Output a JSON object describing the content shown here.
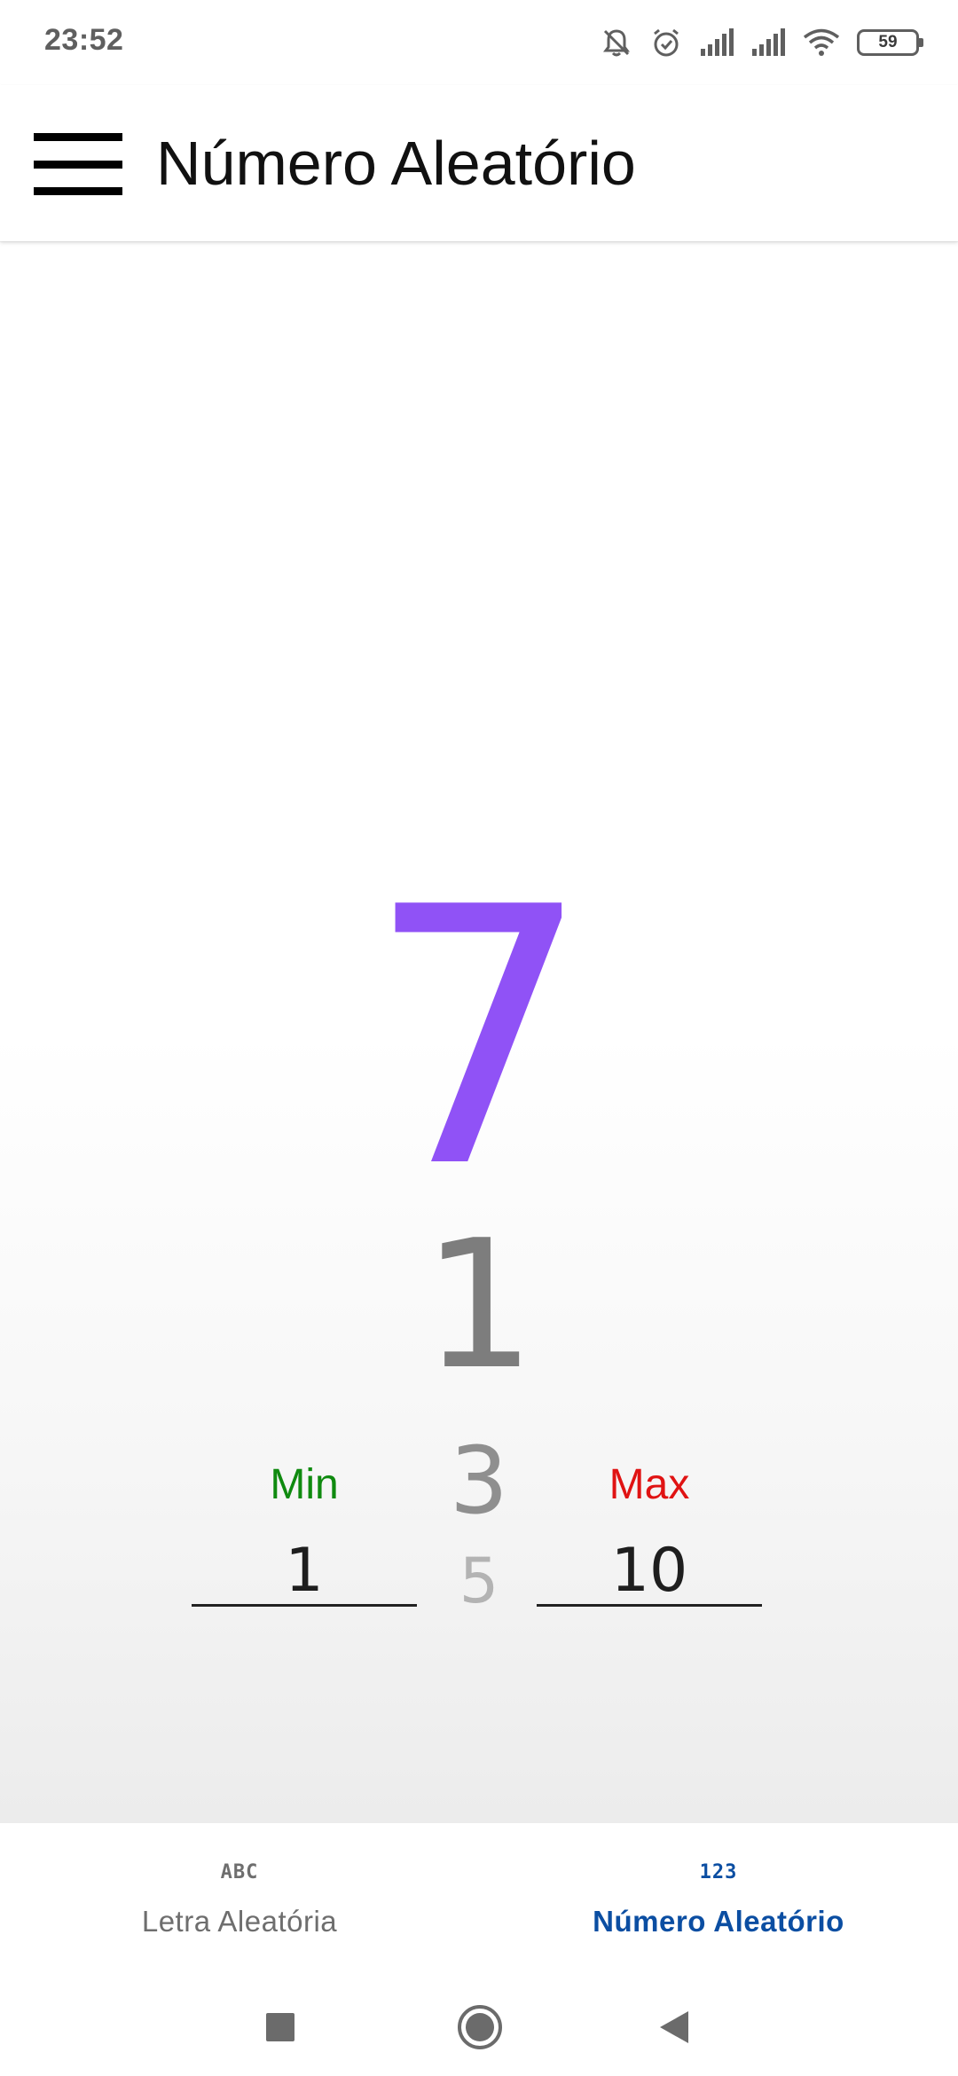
{
  "status_bar": {
    "time": "23:52",
    "battery_level": "59",
    "icons": [
      "notifications-off-icon",
      "alarm-icon",
      "signal-icon",
      "signal-icon",
      "wifi-icon",
      "battery-icon"
    ]
  },
  "app_bar": {
    "title": "Número Aleatório",
    "menu_icon": "hamburger-menu-icon"
  },
  "main": {
    "result": "7",
    "wheel": [
      "1",
      "3",
      "5"
    ],
    "min": {
      "label": "Min",
      "value": "1"
    },
    "max": {
      "label": "Max",
      "value": "10"
    }
  },
  "bottom_nav": {
    "items": [
      {
        "icon_text": "ABC",
        "label": "Letra Aleatória",
        "active": false
      },
      {
        "icon_text": "123",
        "label": "Número Aleatório",
        "active": true
      }
    ]
  },
  "system_nav": {
    "buttons": [
      "recents-icon",
      "home-icon",
      "back-icon"
    ]
  },
  "colors": {
    "result": "#9052f6",
    "min_label": "#0f8a0f",
    "max_label": "#e01313",
    "nav_active": "#0b4ea2",
    "nav_inactive": "#6e6e6e"
  }
}
